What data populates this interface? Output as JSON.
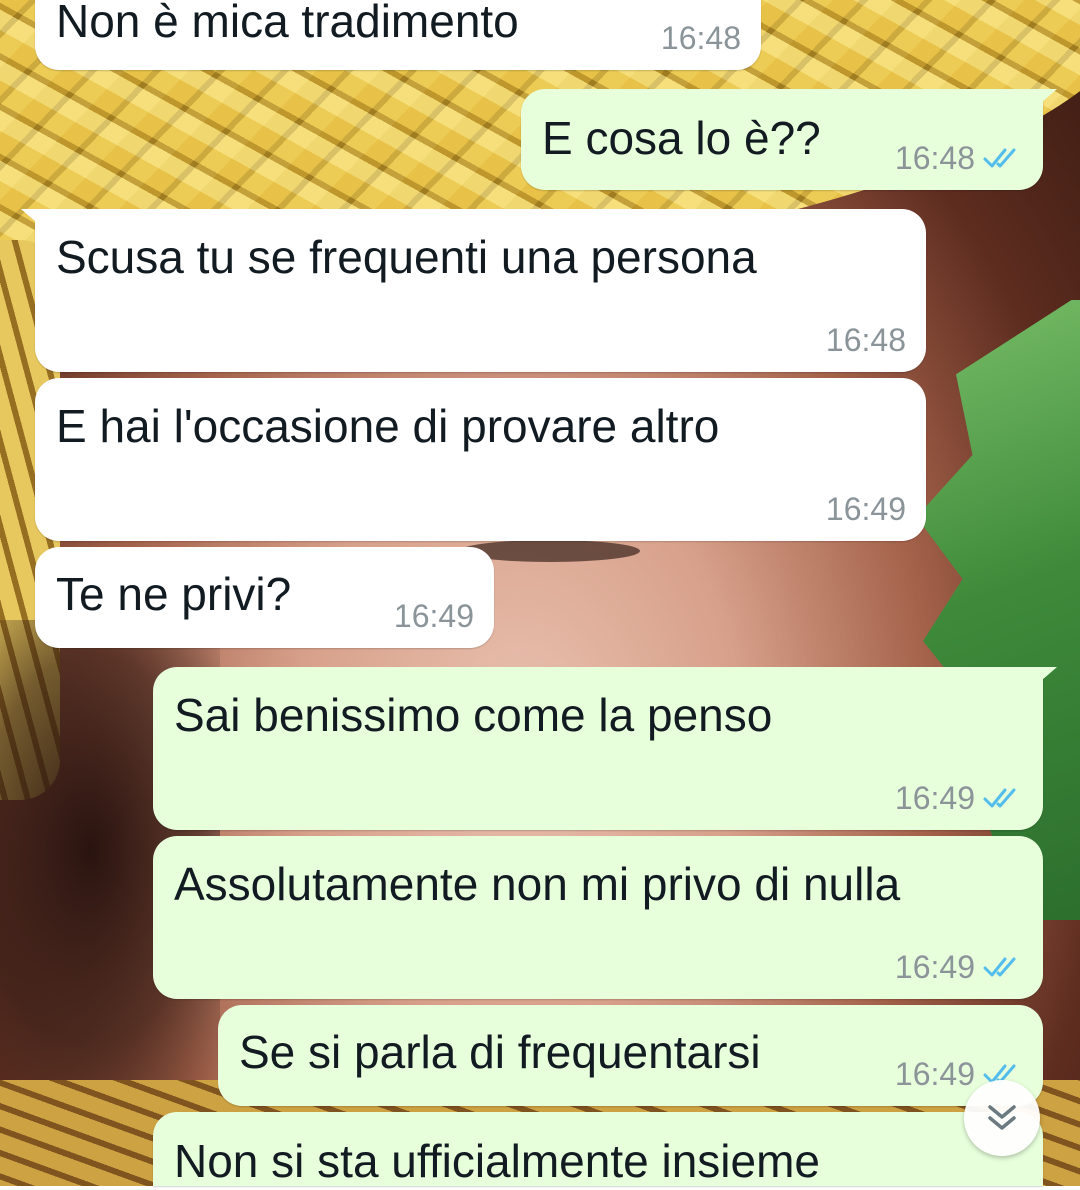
{
  "colors": {
    "incoming_bubble": "#ffffff",
    "outgoing_bubble": "#e7ffdb",
    "text": "#111b21",
    "timestamp": "#8a9499",
    "read_ticks": "#53bdeb"
  },
  "messages": [
    {
      "direction": "incoming",
      "text": "Non è mica tradimento",
      "time": "16:48"
    },
    {
      "direction": "outgoing",
      "text": "E cosa lo è??",
      "time": "16:48",
      "status": "read"
    },
    {
      "direction": "incoming",
      "text": "Scusa tu se frequenti una persona",
      "time": "16:48"
    },
    {
      "direction": "incoming",
      "text": "E hai l'occasione di provare altro",
      "time": "16:49"
    },
    {
      "direction": "incoming",
      "text": "Te ne privi?",
      "time": "16:49"
    },
    {
      "direction": "outgoing",
      "text": "Sai benissimo come la penso",
      "time": "16:49",
      "status": "read"
    },
    {
      "direction": "outgoing",
      "text": "Assolutamente non mi privo di nulla",
      "time": "16:49",
      "status": "read"
    },
    {
      "direction": "outgoing",
      "text": "Se si parla di frequentarsi",
      "time": "16:49",
      "status": "read"
    },
    {
      "direction": "outgoing",
      "text": "Non si sta ufficialmente insieme",
      "time": "",
      "status": ""
    }
  ],
  "scroll_button_icon": "double-chevron-down-icon"
}
